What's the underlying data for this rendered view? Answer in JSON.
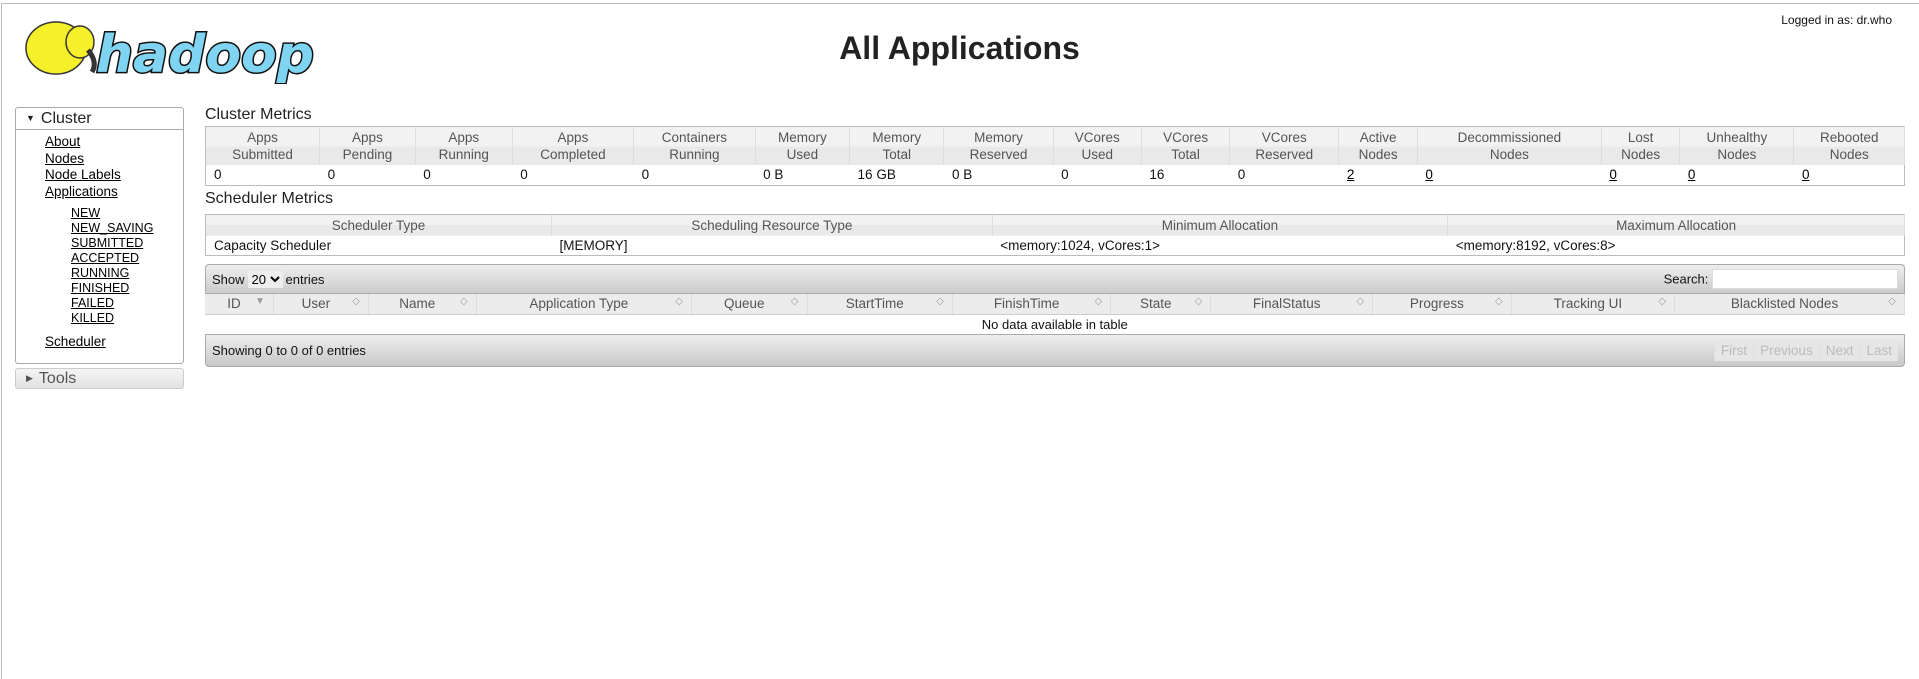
{
  "header": {
    "title": "All Applications",
    "logged_in": "Logged in as: dr.who",
    "logo_text": "hadoop"
  },
  "sidebar": {
    "cluster_label": "Cluster",
    "links": [
      "About",
      "Nodes",
      "Node Labels",
      "Applications"
    ],
    "app_states": [
      "NEW",
      "NEW_SAVING",
      "SUBMITTED",
      "ACCEPTED",
      "RUNNING",
      "FINISHED",
      "FAILED",
      "KILLED"
    ],
    "scheduler": "Scheduler",
    "tools_label": "Tools"
  },
  "cluster_metrics": {
    "title": "Cluster Metrics",
    "headers": [
      [
        "Apps",
        "Submitted"
      ],
      [
        "Apps",
        "Pending"
      ],
      [
        "Apps",
        "Running"
      ],
      [
        "Apps",
        "Completed"
      ],
      [
        "Containers",
        "Running"
      ],
      [
        "Memory",
        "Used"
      ],
      [
        "Memory",
        "Total"
      ],
      [
        "Memory",
        "Reserved"
      ],
      [
        "VCores",
        "Used"
      ],
      [
        "VCores",
        "Total"
      ],
      [
        "VCores",
        "Reserved"
      ],
      [
        "Active",
        "Nodes"
      ],
      [
        "Decommissioned",
        "Nodes"
      ],
      [
        "Lost",
        "Nodes"
      ],
      [
        "Unhealthy",
        "Nodes"
      ],
      [
        "Rebooted",
        "Nodes"
      ]
    ],
    "values": [
      "0",
      "0",
      "0",
      "0",
      "0",
      "0 B",
      "16 GB",
      "0 B",
      "0",
      "16",
      "0",
      "2",
      "0",
      "0",
      "0",
      "0"
    ]
  },
  "scheduler_metrics": {
    "title": "Scheduler Metrics",
    "headers": [
      "Scheduler Type",
      "Scheduling Resource Type",
      "Minimum Allocation",
      "Maximum Allocation"
    ],
    "values": [
      "Capacity Scheduler",
      "[MEMORY]",
      "<memory:1024, vCores:1>",
      "<memory:8192, vCores:8>"
    ]
  },
  "apps_table": {
    "show": "Show",
    "entries": "entries",
    "page_size": "20",
    "search_label": "Search:",
    "search_value": "",
    "columns": [
      "ID",
      "User",
      "Name",
      "Application Type",
      "Queue",
      "StartTime",
      "FinishTime",
      "State",
      "FinalStatus",
      "Progress",
      "Tracking UI",
      "Blacklisted Nodes"
    ],
    "empty": "No data available in table",
    "info": "Showing 0 to 0 of 0 entries",
    "pager": [
      "First",
      "Previous",
      "Next",
      "Last"
    ]
  }
}
